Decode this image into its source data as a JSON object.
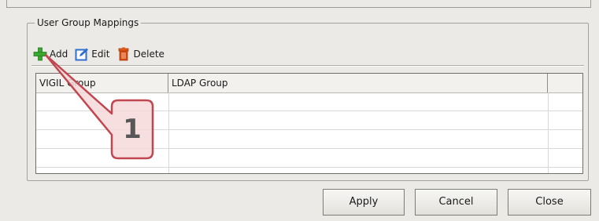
{
  "group": {
    "title": "User Group Mappings"
  },
  "toolbar": {
    "add_label": "Add",
    "edit_label": "Edit",
    "delete_label": "Delete"
  },
  "table": {
    "columns": [
      "VIGIL Group",
      "LDAP Group",
      ""
    ],
    "rows": [
      [
        "",
        "",
        ""
      ],
      [
        "",
        "",
        ""
      ],
      [
        "",
        "",
        ""
      ],
      [
        "",
        "",
        ""
      ]
    ]
  },
  "buttons": {
    "apply": "Apply",
    "cancel": "Cancel",
    "close": "Close"
  },
  "callout": {
    "number": "1"
  },
  "colors": {
    "add_icon": "#3aa82e",
    "edit_icon": "#2f6fd0",
    "delete_icon": "#d24a12",
    "callout_fill": "#f6d9da",
    "callout_border": "#c0474f"
  },
  "icons": [
    "plus-icon",
    "edit-icon",
    "trash-icon"
  ]
}
